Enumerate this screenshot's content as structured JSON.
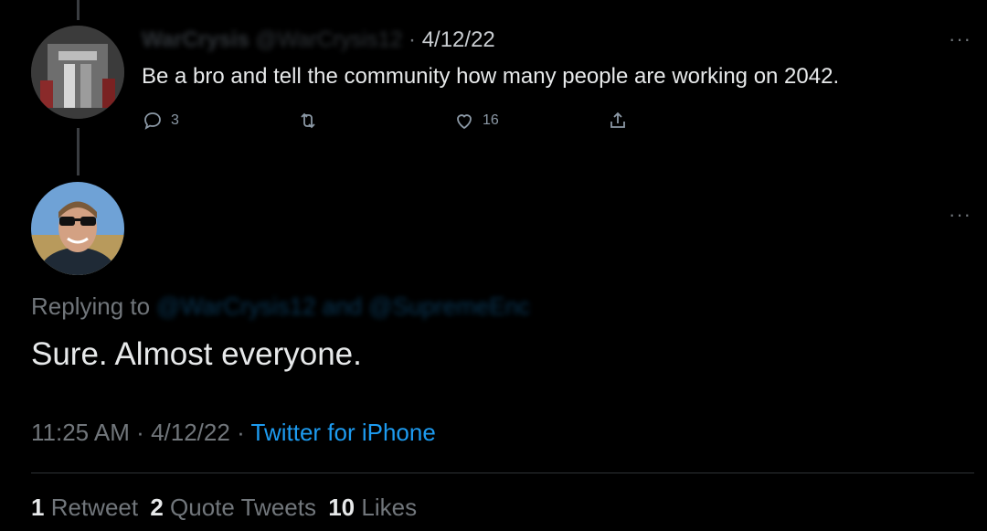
{
  "parent_tweet": {
    "display_name": "WarCrysis",
    "handle": "@WarCrysis12",
    "date_sep": "·",
    "date": "4/12/22",
    "text": "Be a bro and tell the community how many people are working on 2042.",
    "more": "···",
    "replies": "3",
    "likes": "16"
  },
  "reply_tweet": {
    "display_name": "",
    "handle": "",
    "more": "···",
    "replying_label": "Replying to",
    "replying_handles": "@WarCrysis12 and @SupremeEnc",
    "text": "Sure. Almost everyone.",
    "time": "11:25 AM",
    "sep1": "·",
    "date": "4/12/22",
    "sep2": "·",
    "source": "Twitter for iPhone",
    "stats": {
      "retweets_count": "1",
      "retweets_label": "Retweet",
      "quotes_count": "2",
      "quotes_label": "Quote Tweets",
      "likes_count": "10",
      "likes_label": "Likes"
    }
  },
  "icons": {
    "reply": "reply-icon",
    "retweet": "retweet-icon",
    "like": "heart-icon",
    "share": "share-icon"
  },
  "colors": {
    "background": "#000000",
    "text": "#e7e9ea",
    "muted": "#71767b",
    "link": "#1d9bf0",
    "divider": "#2f3336"
  }
}
